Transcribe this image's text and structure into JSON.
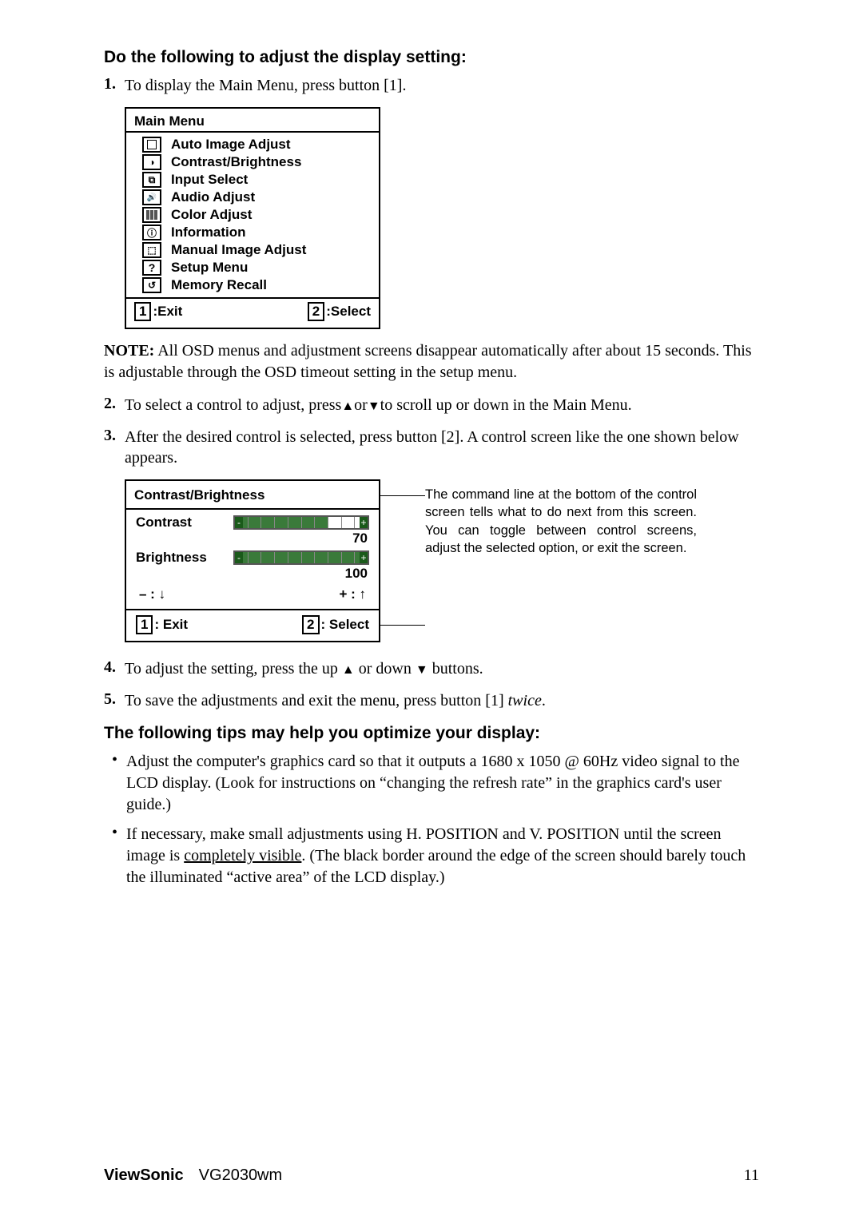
{
  "heading1": "Do the following to adjust the display setting:",
  "step1": {
    "num": "1.",
    "text": "To display the Main Menu, press button [1]."
  },
  "osd": {
    "title": "Main Menu",
    "items": [
      {
        "label": "Auto Image Adjust"
      },
      {
        "label": "Contrast/Brightness"
      },
      {
        "label": "Input Select"
      },
      {
        "label": "Audio Adjust"
      },
      {
        "label": "Color Adjust"
      },
      {
        "label": "Information"
      },
      {
        "label": "Manual Image Adjust"
      },
      {
        "label": "Setup Menu"
      },
      {
        "label": "Memory Recall"
      }
    ],
    "foot_left_key": "1",
    "foot_left_label": ":Exit",
    "foot_right_key": "2",
    "foot_right_label": ":Select"
  },
  "note_label": "NOTE:",
  "note_text": " All OSD menus and adjustment screens disappear automatically after about 15 seconds. This is adjustable through the OSD timeout setting in the setup menu.",
  "step2": {
    "num": "2.",
    "pre": "To select a control to adjust, press",
    "mid": "or",
    "post": "to scroll up or down in the Main Menu."
  },
  "step3": {
    "num": "3.",
    "text": "After the desired control is selected, press button [2]. A control screen like the one shown below appears."
  },
  "cb": {
    "title": "Contrast/Brightness",
    "row1_label": "Contrast",
    "row1_value": "70",
    "row2_label": "Brightness",
    "row2_value": "100",
    "ctrl_left": "– : ",
    "ctrl_right": "+ : ",
    "foot_left_key": "1",
    "foot_left_label": ": Exit",
    "foot_right_key": "2",
    "foot_right_label": ": Select"
  },
  "caption": "The command line at the bottom of the control screen tells what to do next from this screen. You can toggle between control screens, adjust the selected option, or exit the screen.",
  "step4": {
    "num": "4.",
    "pre": "To adjust the setting, press the up ",
    "mid": " or down ",
    "post": " buttons."
  },
  "step5": {
    "num": "5.",
    "pre": "To save the adjustments and exit the menu, press button [1] ",
    "em": "twice",
    "post": "."
  },
  "heading2": "The following tips may help you optimize your display:",
  "tip1": "Adjust the computer's graphics card so that it outputs a 1680 x 1050 @ 60Hz video signal to the LCD display. (Look for instructions on “changing the refresh rate” in the graphics card's user guide.)",
  "tip2_pre": "If necessary, make small adjustments using H. POSITION and V. POSITION until the screen image is ",
  "tip2_u": "completely visible",
  "tip2_post": ". (The black border around the edge of the screen should barely touch the illuminated “active area” of the LCD display.)",
  "footer": {
    "brand": "ViewSonic",
    "model": "VG2030wm",
    "page": "11"
  }
}
